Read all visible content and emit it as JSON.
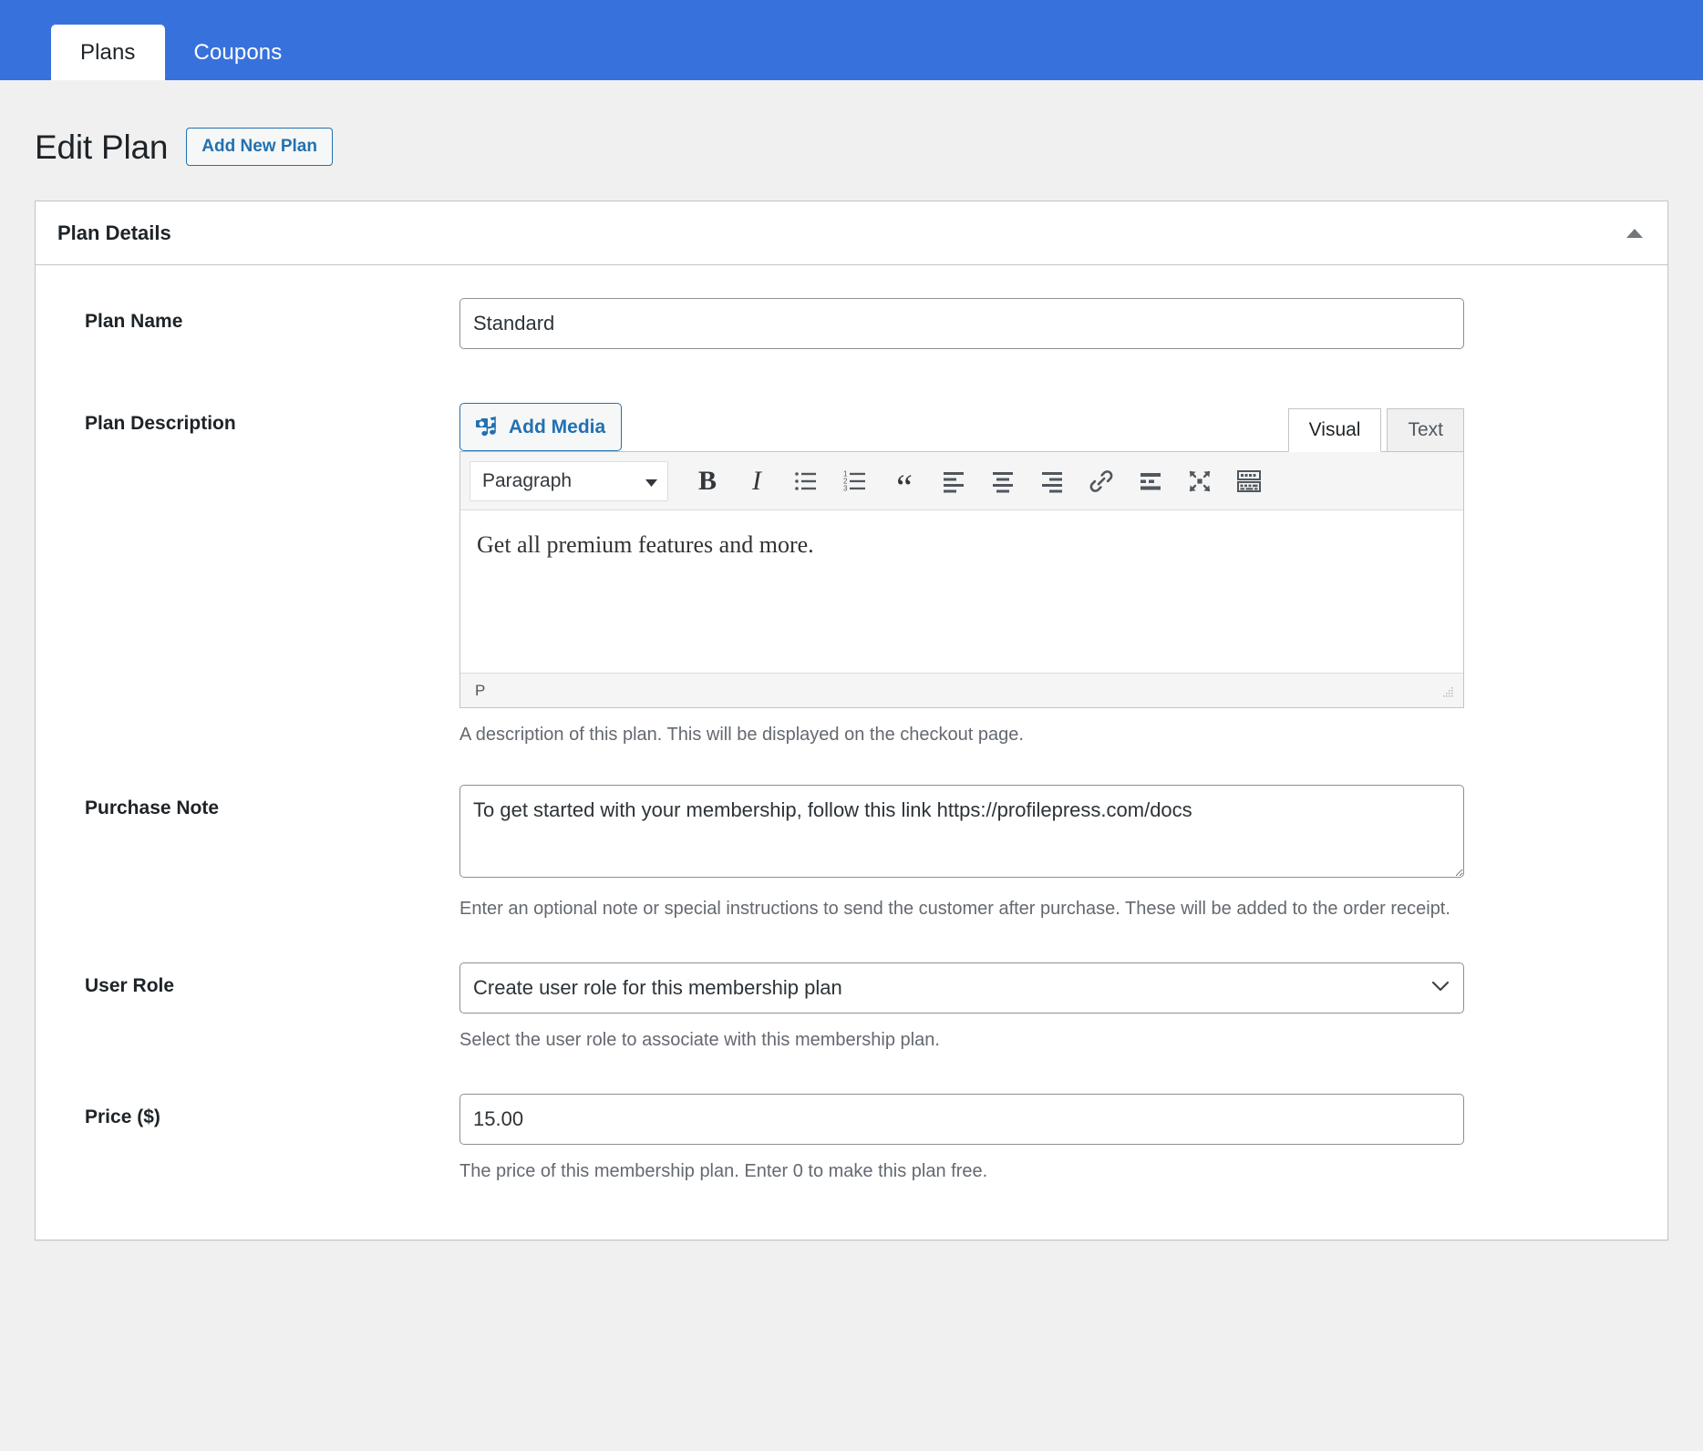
{
  "tabs": [
    {
      "label": "Plans",
      "active": true
    },
    {
      "label": "Coupons",
      "active": false
    }
  ],
  "page": {
    "title": "Edit Plan",
    "add_new_label": "Add New Plan"
  },
  "card": {
    "title": "Plan Details",
    "collapse_icon": "triangle-up-icon"
  },
  "fields": {
    "plan_name": {
      "label": "Plan Name",
      "value": "Standard",
      "placeholder": ""
    },
    "plan_description": {
      "label": "Plan Description",
      "add_media_label": "Add Media",
      "add_media_icon": "media-camera-note-icon",
      "editor_tabs": [
        {
          "label": "Visual",
          "active": true
        },
        {
          "label": "Text",
          "active": false
        }
      ],
      "format_select": "Paragraph",
      "toolbar": [
        {
          "name": "bold-icon",
          "glyph": "B"
        },
        {
          "name": "italic-icon",
          "glyph": "I"
        },
        {
          "name": "bulleted-list-icon",
          "glyph": ""
        },
        {
          "name": "numbered-list-icon",
          "glyph": ""
        },
        {
          "name": "blockquote-icon",
          "glyph": "“"
        },
        {
          "name": "align-left-icon",
          "glyph": ""
        },
        {
          "name": "align-center-icon",
          "glyph": ""
        },
        {
          "name": "align-right-icon",
          "glyph": ""
        },
        {
          "name": "insert-link-icon",
          "glyph": ""
        },
        {
          "name": "read-more-icon",
          "glyph": ""
        },
        {
          "name": "fullscreen-icon",
          "glyph": ""
        },
        {
          "name": "toolbar-toggle-icon",
          "glyph": ""
        }
      ],
      "content": "Get all premium features and more.",
      "status_path": "P",
      "helper": "A description of this plan. This will be displayed on the checkout page."
    },
    "purchase_note": {
      "label": "Purchase Note",
      "value": "To get started with your membership, follow this link https://profilepress.com/docs",
      "helper": "Enter an optional note or special instructions to send the customer after purchase. These will be added to the order receipt."
    },
    "user_role": {
      "label": "User Role",
      "value": "Create user role for this membership plan",
      "helper": "Select the user role to associate with this membership plan.",
      "caret_icon": "chevron-down-icon"
    },
    "price": {
      "label": "Price ($)",
      "value": "15.00",
      "helper": "The price of this membership plan. Enter 0 to make this plan free."
    }
  },
  "colors": {
    "brand_blue": "#3772dc",
    "link_blue": "#2271b1",
    "page_bg": "#f0f0f1",
    "border": "#c3c4c7",
    "text": "#1d2327",
    "muted": "#646970"
  }
}
